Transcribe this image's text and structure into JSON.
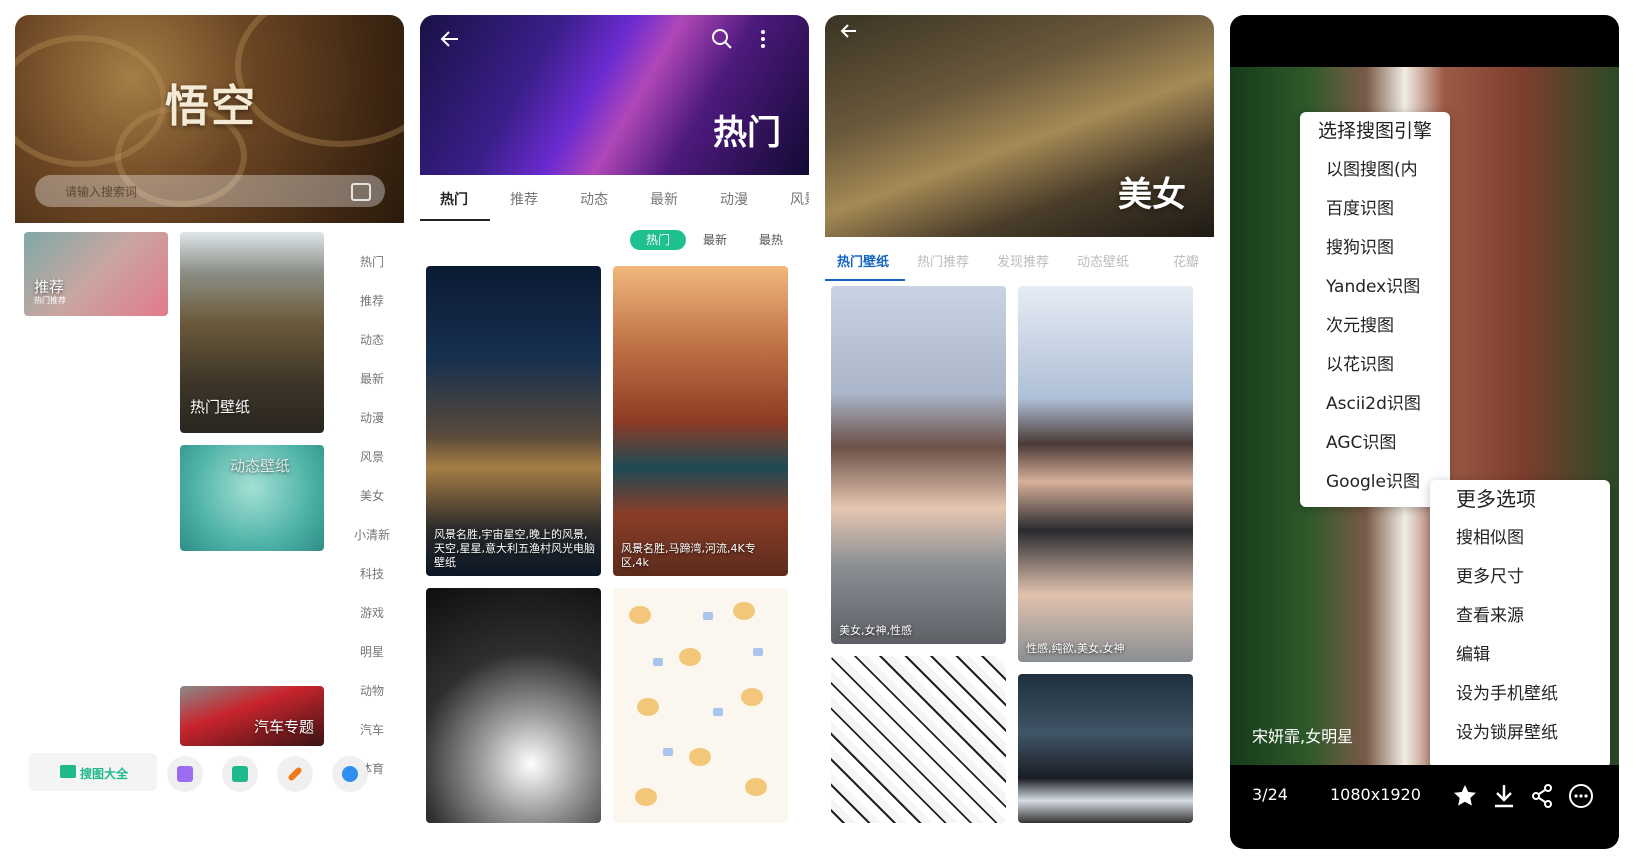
{
  "phone1": {
    "search_placeholder": "请输入搜索词",
    "tiles": {
      "recommend": {
        "label": "推荐",
        "sub": "热门推荐"
      },
      "hot": {
        "label": "热门壁纸"
      },
      "dynamic": {
        "label": "动态壁纸"
      },
      "car": {
        "label": "汽车专题"
      }
    },
    "categories": [
      "热门",
      "推荐",
      "动态",
      "最新",
      "动漫",
      "风景",
      "美女",
      "小清新",
      "科技",
      "游戏",
      "明星",
      "动物",
      "汽车",
      "体育"
    ],
    "bottom": {
      "main_label": "搜图大全"
    }
  },
  "phone2": {
    "title": "热门",
    "tabs": [
      "热门",
      "推荐",
      "动态",
      "最新",
      "动漫",
      "风景"
    ],
    "sort": [
      "热门",
      "最新",
      "最热"
    ],
    "cards": [
      {
        "caption": "风景名胜,宇宙星空,晚上的风景,天空,星星,意大利五渔村风光电脑壁纸"
      },
      {
        "caption": "风景名胜,马蹄湾,河流,4K专区,4k"
      }
    ]
  },
  "phone3": {
    "title": "美女",
    "tabs": [
      "热门壁纸",
      "热门推荐",
      "发现推荐",
      "动态壁纸",
      "花瓣"
    ],
    "cards": [
      {
        "caption": "美女,女神,性感"
      },
      {
        "caption": "性感,纯欲,美女,女神"
      }
    ]
  },
  "phone4": {
    "engine_menu": {
      "header": "选择搜图引擎",
      "items": [
        "以图搜图(内",
        "百度识图",
        "搜狗识图",
        "Yandex识图",
        "次元搜图",
        "以花识图",
        "Ascii2d识图",
        "AGC识图",
        "Google识图"
      ]
    },
    "more_menu": {
      "header": "更多选项",
      "items": [
        "搜相似图",
        "更多尺寸",
        "查看来源",
        "编辑",
        "设为手机壁纸",
        "设为锁屏壁纸"
      ]
    },
    "caption": "宋妍霏,女明星",
    "counter": "3/24",
    "resolution": "1080x1920"
  },
  "colors": {
    "accent": "#1fc08f",
    "blue": "#1565c0"
  }
}
